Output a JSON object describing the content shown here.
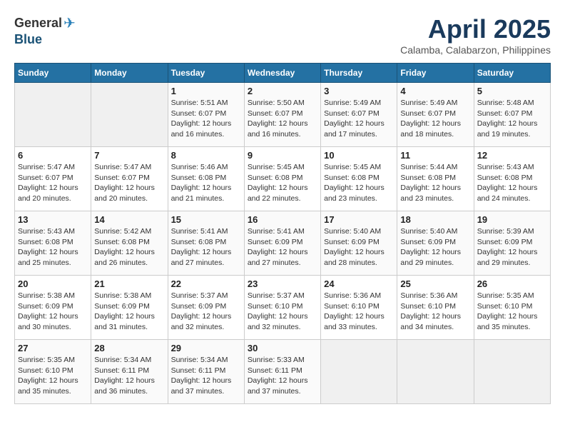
{
  "header": {
    "logo_general": "General",
    "logo_blue": "Blue",
    "month_title": "April 2025",
    "location": "Calamba, Calabarzon, Philippines"
  },
  "weekdays": [
    "Sunday",
    "Monday",
    "Tuesday",
    "Wednesday",
    "Thursday",
    "Friday",
    "Saturday"
  ],
  "weeks": [
    [
      {
        "day": "",
        "info": ""
      },
      {
        "day": "",
        "info": ""
      },
      {
        "day": "1",
        "info": "Sunrise: 5:51 AM\nSunset: 6:07 PM\nDaylight: 12 hours and 16 minutes."
      },
      {
        "day": "2",
        "info": "Sunrise: 5:50 AM\nSunset: 6:07 PM\nDaylight: 12 hours and 16 minutes."
      },
      {
        "day": "3",
        "info": "Sunrise: 5:49 AM\nSunset: 6:07 PM\nDaylight: 12 hours and 17 minutes."
      },
      {
        "day": "4",
        "info": "Sunrise: 5:49 AM\nSunset: 6:07 PM\nDaylight: 12 hours and 18 minutes."
      },
      {
        "day": "5",
        "info": "Sunrise: 5:48 AM\nSunset: 6:07 PM\nDaylight: 12 hours and 19 minutes."
      }
    ],
    [
      {
        "day": "6",
        "info": "Sunrise: 5:47 AM\nSunset: 6:07 PM\nDaylight: 12 hours and 20 minutes."
      },
      {
        "day": "7",
        "info": "Sunrise: 5:47 AM\nSunset: 6:07 PM\nDaylight: 12 hours and 20 minutes."
      },
      {
        "day": "8",
        "info": "Sunrise: 5:46 AM\nSunset: 6:08 PM\nDaylight: 12 hours and 21 minutes."
      },
      {
        "day": "9",
        "info": "Sunrise: 5:45 AM\nSunset: 6:08 PM\nDaylight: 12 hours and 22 minutes."
      },
      {
        "day": "10",
        "info": "Sunrise: 5:45 AM\nSunset: 6:08 PM\nDaylight: 12 hours and 23 minutes."
      },
      {
        "day": "11",
        "info": "Sunrise: 5:44 AM\nSunset: 6:08 PM\nDaylight: 12 hours and 23 minutes."
      },
      {
        "day": "12",
        "info": "Sunrise: 5:43 AM\nSunset: 6:08 PM\nDaylight: 12 hours and 24 minutes."
      }
    ],
    [
      {
        "day": "13",
        "info": "Sunrise: 5:43 AM\nSunset: 6:08 PM\nDaylight: 12 hours and 25 minutes."
      },
      {
        "day": "14",
        "info": "Sunrise: 5:42 AM\nSunset: 6:08 PM\nDaylight: 12 hours and 26 minutes."
      },
      {
        "day": "15",
        "info": "Sunrise: 5:41 AM\nSunset: 6:08 PM\nDaylight: 12 hours and 27 minutes."
      },
      {
        "day": "16",
        "info": "Sunrise: 5:41 AM\nSunset: 6:09 PM\nDaylight: 12 hours and 27 minutes."
      },
      {
        "day": "17",
        "info": "Sunrise: 5:40 AM\nSunset: 6:09 PM\nDaylight: 12 hours and 28 minutes."
      },
      {
        "day": "18",
        "info": "Sunrise: 5:40 AM\nSunset: 6:09 PM\nDaylight: 12 hours and 29 minutes."
      },
      {
        "day": "19",
        "info": "Sunrise: 5:39 AM\nSunset: 6:09 PM\nDaylight: 12 hours and 29 minutes."
      }
    ],
    [
      {
        "day": "20",
        "info": "Sunrise: 5:38 AM\nSunset: 6:09 PM\nDaylight: 12 hours and 30 minutes."
      },
      {
        "day": "21",
        "info": "Sunrise: 5:38 AM\nSunset: 6:09 PM\nDaylight: 12 hours and 31 minutes."
      },
      {
        "day": "22",
        "info": "Sunrise: 5:37 AM\nSunset: 6:09 PM\nDaylight: 12 hours and 32 minutes."
      },
      {
        "day": "23",
        "info": "Sunrise: 5:37 AM\nSunset: 6:10 PM\nDaylight: 12 hours and 32 minutes."
      },
      {
        "day": "24",
        "info": "Sunrise: 5:36 AM\nSunset: 6:10 PM\nDaylight: 12 hours and 33 minutes."
      },
      {
        "day": "25",
        "info": "Sunrise: 5:36 AM\nSunset: 6:10 PM\nDaylight: 12 hours and 34 minutes."
      },
      {
        "day": "26",
        "info": "Sunrise: 5:35 AM\nSunset: 6:10 PM\nDaylight: 12 hours and 35 minutes."
      }
    ],
    [
      {
        "day": "27",
        "info": "Sunrise: 5:35 AM\nSunset: 6:10 PM\nDaylight: 12 hours and 35 minutes."
      },
      {
        "day": "28",
        "info": "Sunrise: 5:34 AM\nSunset: 6:11 PM\nDaylight: 12 hours and 36 minutes."
      },
      {
        "day": "29",
        "info": "Sunrise: 5:34 AM\nSunset: 6:11 PM\nDaylight: 12 hours and 37 minutes."
      },
      {
        "day": "30",
        "info": "Sunrise: 5:33 AM\nSunset: 6:11 PM\nDaylight: 12 hours and 37 minutes."
      },
      {
        "day": "",
        "info": ""
      },
      {
        "day": "",
        "info": ""
      },
      {
        "day": "",
        "info": ""
      }
    ]
  ]
}
